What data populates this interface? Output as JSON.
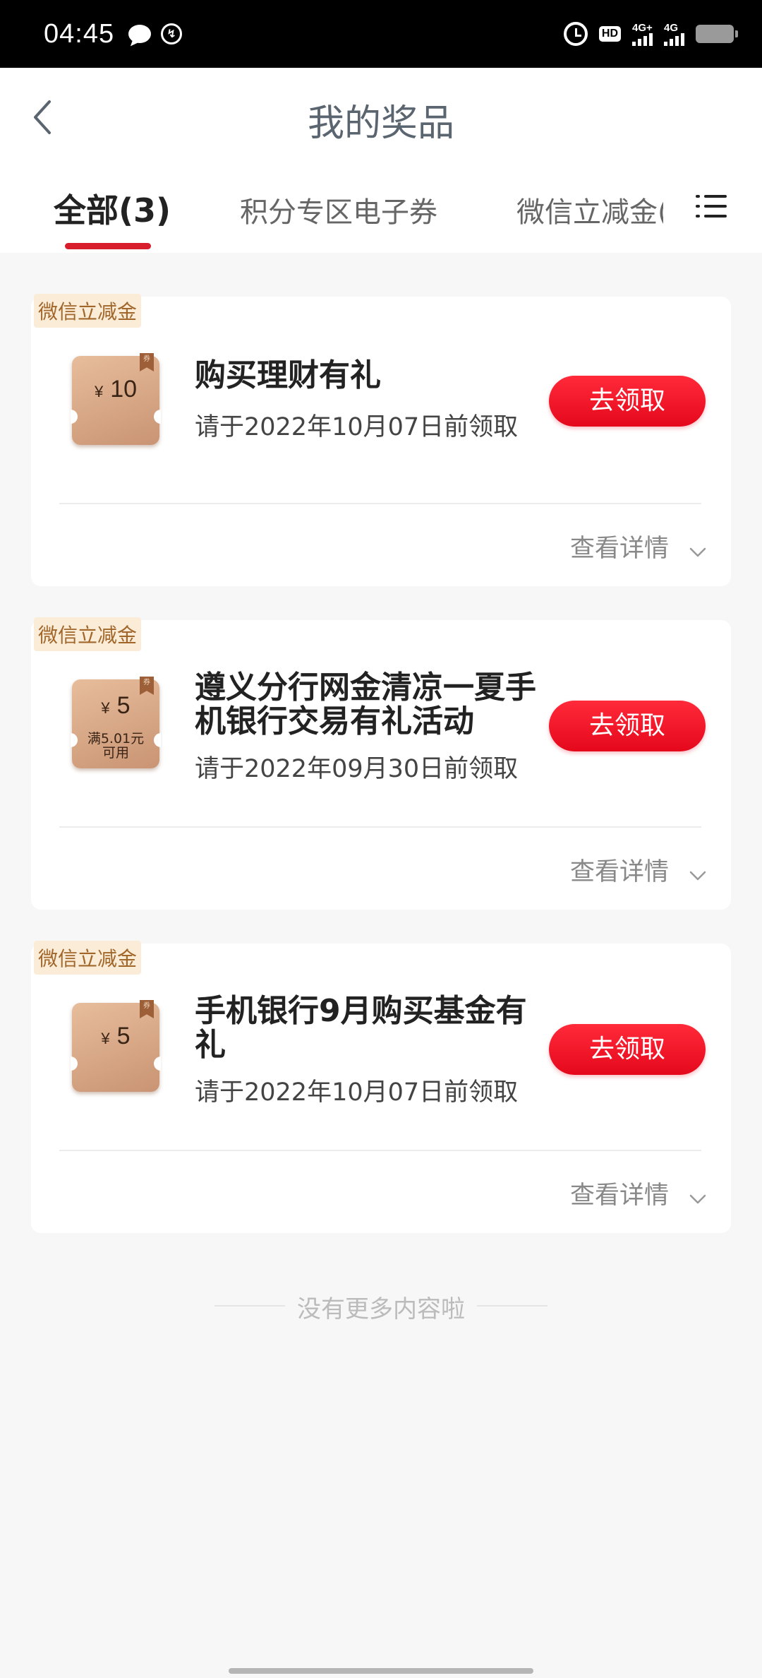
{
  "status_bar": {
    "time": "04:45",
    "hd_label": "HD",
    "signal1_label": "4G+",
    "signal2_label": "4G"
  },
  "header": {
    "title": "我的奖品",
    "tabs": [
      {
        "label": "全部(3)",
        "active": true
      },
      {
        "label": "积分专区电子券",
        "active": false
      },
      {
        "label": "微信立减金(",
        "active": false
      }
    ]
  },
  "cards": [
    {
      "tag": "微信立减金",
      "coupon": {
        "currency": "¥",
        "amount": "10",
        "condition": "",
        "ribbon": "券"
      },
      "title": "购买理财有礼",
      "date": "请于2022年10月07日前领取",
      "button": "去领取",
      "detail": "查看详情"
    },
    {
      "tag": "微信立减金",
      "coupon": {
        "currency": "¥",
        "amount": "5",
        "condition_line1": "满5.01元",
        "condition_line2": "可用",
        "ribbon": "券"
      },
      "title": "遵义分行网金清凉一夏手机银行交易有礼活动",
      "date": "请于2022年09月30日前领取",
      "button": "去领取",
      "detail": "查看详情"
    },
    {
      "tag": "微信立减金",
      "coupon": {
        "currency": "¥",
        "amount": "5",
        "condition": "",
        "ribbon": "券"
      },
      "title": "手机银行9月购买基金有礼",
      "date": "请于2022年10月07日前领取",
      "button": "去领取",
      "detail": "查看详情"
    }
  ],
  "footer": {
    "end_note": "没有更多内容啦"
  },
  "colors": {
    "accent_red": "#e5081c",
    "tab_underline": "#d81e2c",
    "coupon_bronze": "#d4a27f",
    "tag_text": "#a0662a"
  }
}
